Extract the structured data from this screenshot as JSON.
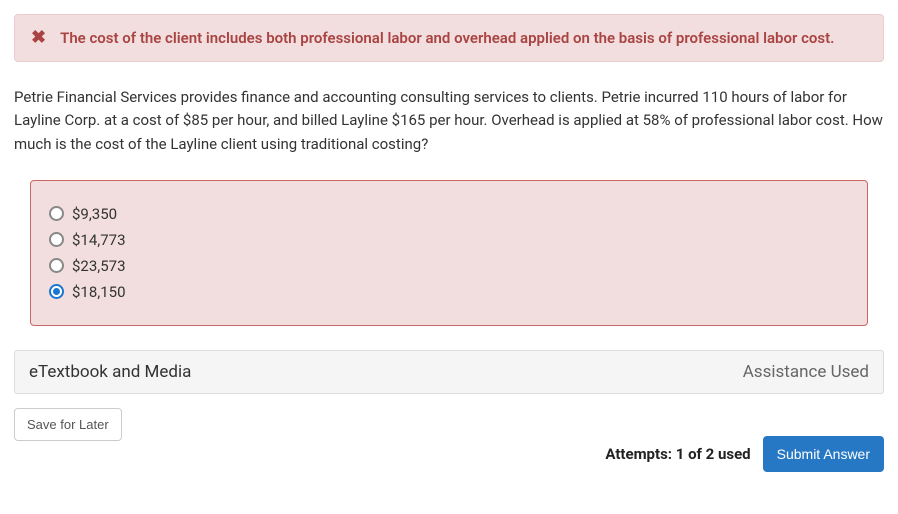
{
  "alert": {
    "icon": "✖",
    "text": "The cost of the client includes both professional labor and overhead applied on the basis of professional labor cost."
  },
  "question": "Petrie Financial Services provides finance and accounting consulting services to clients. Petrie incurred 110 hours of labor for Layline Corp. at a cost of $85 per hour, and billed Layline $165 per hour. Overhead is applied at 58% of professional labor cost. How much is the cost of the Layline client using traditional costing?",
  "options": [
    {
      "label": "$9,350",
      "selected": false
    },
    {
      "label": "$14,773",
      "selected": false
    },
    {
      "label": "$23,573",
      "selected": false
    },
    {
      "label": "$18,150",
      "selected": true
    }
  ],
  "accordion": {
    "left": "eTextbook and Media",
    "right": "Assistance Used"
  },
  "buttons": {
    "save": "Save for Later",
    "submit": "Submit Answer"
  },
  "attempts": "Attempts: 1 of 2 used"
}
